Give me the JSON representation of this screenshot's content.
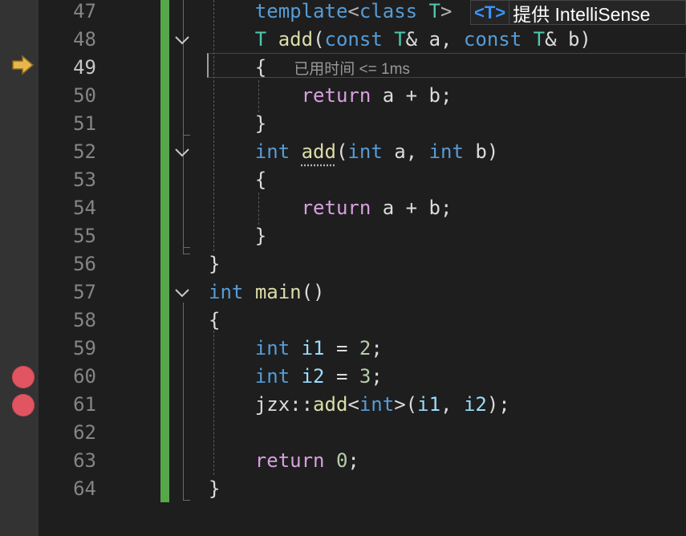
{
  "editor": {
    "lines": [
      {
        "number": "47",
        "tokens": [
          {
            "t": "    ",
            "c": "pl"
          },
          {
            "t": "template",
            "c": "kw"
          },
          {
            "t": "<",
            "c": "pun"
          },
          {
            "t": "class",
            "c": "kw"
          },
          {
            "t": " ",
            "c": "pl"
          },
          {
            "t": "T",
            "c": "ty"
          },
          {
            "t": ">",
            "c": "pun"
          }
        ]
      },
      {
        "number": "48",
        "tokens": [
          {
            "t": "    ",
            "c": "pl"
          },
          {
            "t": "T",
            "c": "ty"
          },
          {
            "t": " ",
            "c": "pl"
          },
          {
            "t": "add",
            "c": "fn"
          },
          {
            "t": "(",
            "c": "pl"
          },
          {
            "t": "const",
            "c": "kw"
          },
          {
            "t": " ",
            "c": "pl"
          },
          {
            "t": "T",
            "c": "ty"
          },
          {
            "t": "& a, ",
            "c": "pl"
          },
          {
            "t": "const",
            "c": "kw"
          },
          {
            "t": " ",
            "c": "pl"
          },
          {
            "t": "T",
            "c": "ty"
          },
          {
            "t": "& b)",
            "c": "pl"
          }
        ]
      },
      {
        "number": "49",
        "tokens": [
          {
            "t": "    {",
            "c": "pl"
          }
        ],
        "hint": "已用时间 <= 1ms"
      },
      {
        "number": "50",
        "tokens": [
          {
            "t": "        ",
            "c": "pl"
          },
          {
            "t": "return",
            "c": "ctl"
          },
          {
            "t": " a + b;",
            "c": "pl"
          }
        ]
      },
      {
        "number": "51",
        "tokens": [
          {
            "t": "    }",
            "c": "pl"
          }
        ]
      },
      {
        "number": "52",
        "tokens": [
          {
            "t": "    ",
            "c": "pl"
          },
          {
            "t": "int",
            "c": "kw"
          },
          {
            "t": " ",
            "c": "pl"
          },
          {
            "t": "add",
            "c": "fn squig"
          },
          {
            "t": "(",
            "c": "pl"
          },
          {
            "t": "int",
            "c": "kw"
          },
          {
            "t": " a, ",
            "c": "pl"
          },
          {
            "t": "int",
            "c": "kw"
          },
          {
            "t": " b)",
            "c": "pl"
          }
        ]
      },
      {
        "number": "53",
        "tokens": [
          {
            "t": "    {",
            "c": "pl"
          }
        ]
      },
      {
        "number": "54",
        "tokens": [
          {
            "t": "        ",
            "c": "pl"
          },
          {
            "t": "return",
            "c": "ctl"
          },
          {
            "t": " a + b;",
            "c": "pl"
          }
        ]
      },
      {
        "number": "55",
        "tokens": [
          {
            "t": "    }",
            "c": "pl"
          }
        ]
      },
      {
        "number": "56",
        "tokens": [
          {
            "t": "}",
            "c": "pl"
          }
        ]
      },
      {
        "number": "57",
        "tokens": [
          {
            "t": "int",
            "c": "kw"
          },
          {
            "t": " ",
            "c": "pl"
          },
          {
            "t": "main",
            "c": "fn"
          },
          {
            "t": "()",
            "c": "pl"
          }
        ]
      },
      {
        "number": "58",
        "tokens": [
          {
            "t": "{",
            "c": "pl"
          }
        ]
      },
      {
        "number": "59",
        "tokens": [
          {
            "t": "    ",
            "c": "pl"
          },
          {
            "t": "int",
            "c": "kw"
          },
          {
            "t": " ",
            "c": "pl"
          },
          {
            "t": "i1",
            "c": "var"
          },
          {
            "t": " = ",
            "c": "pl"
          },
          {
            "t": "2",
            "c": "num"
          },
          {
            "t": ";",
            "c": "pl"
          }
        ]
      },
      {
        "number": "60",
        "tokens": [
          {
            "t": "    ",
            "c": "pl"
          },
          {
            "t": "int",
            "c": "kw"
          },
          {
            "t": " ",
            "c": "pl"
          },
          {
            "t": "i2",
            "c": "var"
          },
          {
            "t": " = ",
            "c": "pl"
          },
          {
            "t": "3",
            "c": "num"
          },
          {
            "t": ";",
            "c": "pl"
          }
        ]
      },
      {
        "number": "61",
        "tokens": [
          {
            "t": "    jzx::",
            "c": "pl"
          },
          {
            "t": "add",
            "c": "fn"
          },
          {
            "t": "<",
            "c": "pl"
          },
          {
            "t": "int",
            "c": "kw"
          },
          {
            "t": ">(",
            "c": "pl"
          },
          {
            "t": "i1",
            "c": "var"
          },
          {
            "t": ", ",
            "c": "pl"
          },
          {
            "t": "i2",
            "c": "var"
          },
          {
            "t": ");",
            "c": "pl"
          }
        ]
      },
      {
        "number": "62",
        "tokens": []
      },
      {
        "number": "63",
        "tokens": [
          {
            "t": "    ",
            "c": "pl"
          },
          {
            "t": "return",
            "c": "ctl"
          },
          {
            "t": " ",
            "c": "pl"
          },
          {
            "t": "0",
            "c": "num"
          },
          {
            "t": ";",
            "c": "pl"
          }
        ]
      },
      {
        "number": "64",
        "tokens": [
          {
            "t": "}",
            "c": "pl"
          }
        ]
      }
    ],
    "current_line": "49",
    "breakpoint_lines": [
      "60",
      "61"
    ],
    "folded_lines": [
      "48",
      "52",
      "57"
    ]
  },
  "tooltip": {
    "icon_text": "<T>",
    "text": "提供 IntelliSense"
  },
  "icons": {
    "execution_pointer": "current-statement-arrow-icon",
    "breakpoint": "breakpoint-icon",
    "fold": "chevron-down-icon"
  },
  "colors": {
    "breakpoint": "#e05561",
    "change_bar": "#57a64a",
    "arrow": "#e8b64a",
    "keyword": "#569cd6",
    "control": "#d8a0df",
    "type": "#4ec9b0",
    "function": "#dcdcaa",
    "number": "#b5cea8",
    "variable": "#9cdcfe"
  }
}
